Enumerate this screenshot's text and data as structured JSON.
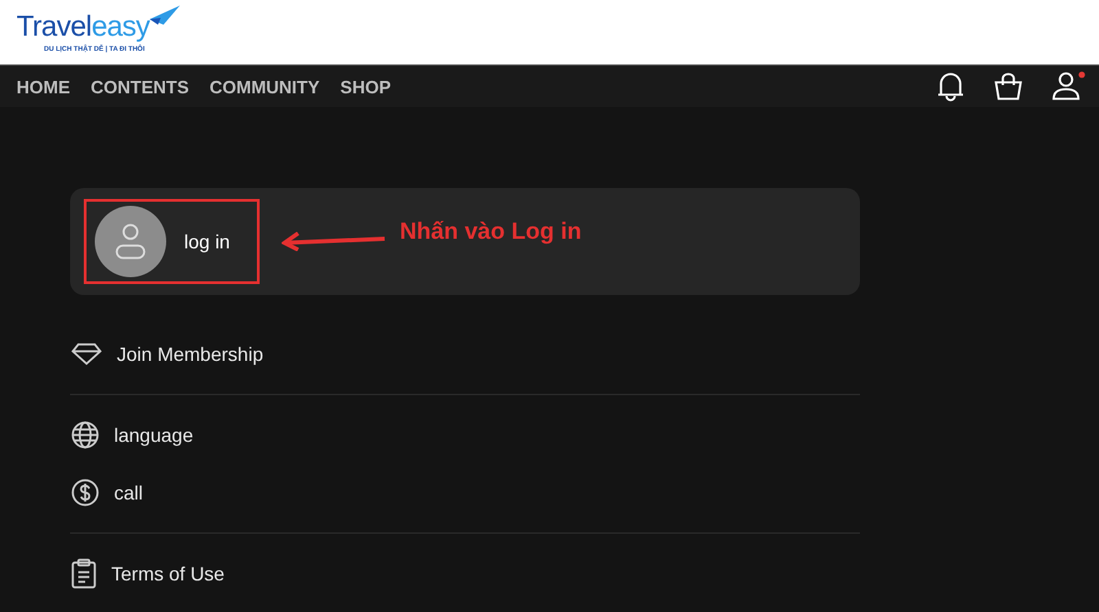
{
  "logo": {
    "first": "Travel",
    "second": "easy",
    "tagline": "DU LỊCH THẬT DỄ | TA ĐI THÔI"
  },
  "nav": [
    "HOME",
    "CONTENTS",
    "COMMUNITY",
    "SHOP"
  ],
  "header_icons": {
    "user_badge": true
  },
  "login": {
    "label": "log in"
  },
  "annotation": {
    "text": "Nhấn vào Log in"
  },
  "menu_groups": [
    [
      {
        "kind": "diamond",
        "label": "Join Membership"
      }
    ],
    [
      {
        "kind": "globe",
        "label": "language"
      },
      {
        "kind": "dollar",
        "label": "call"
      }
    ],
    [
      {
        "kind": "clipboard",
        "label": "Terms of Use"
      }
    ]
  ]
}
